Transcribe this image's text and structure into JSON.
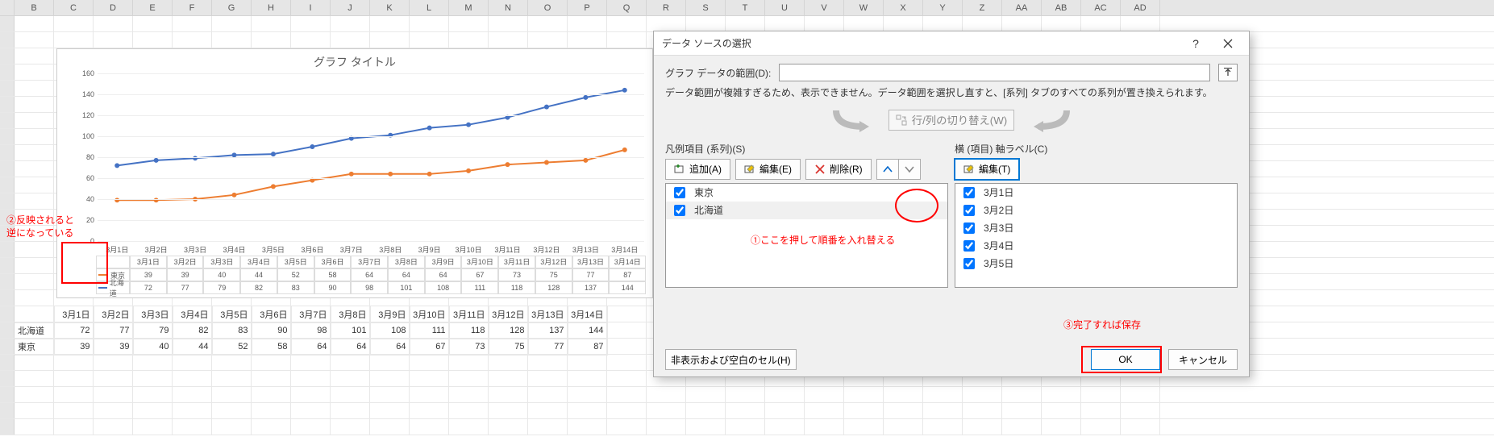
{
  "columns": [
    "B",
    "C",
    "D",
    "E",
    "F",
    "G",
    "H",
    "I",
    "J",
    "K",
    "L",
    "M",
    "N",
    "O",
    "P",
    "Q",
    "R",
    "S",
    "T",
    "U",
    "V",
    "W",
    "X",
    "Y",
    "Z",
    "AA",
    "AB",
    "AC",
    "AD"
  ],
  "rows": [
    "",
    "",
    "",
    "",
    "",
    "",
    "",
    "",
    "",
    "",
    "",
    "",
    "",
    "",
    "",
    "",
    "",
    "",
    "",
    "",
    "",
    "",
    "",
    "",
    "",
    ""
  ],
  "chart": {
    "title": "グラフ タイトル"
  },
  "chart_data": {
    "type": "line",
    "categories": [
      "3月1日",
      "3月2日",
      "3月3日",
      "3月4日",
      "3月5日",
      "3月6日",
      "3月7日",
      "3月8日",
      "3月9日",
      "3月10日",
      "3月11日",
      "3月12日",
      "3月13日",
      "3月14日"
    ],
    "series": [
      {
        "name": "東京",
        "color": "#ed7d31",
        "values": [
          39,
          39,
          40,
          44,
          52,
          58,
          64,
          64,
          64,
          67,
          73,
          75,
          77,
          87
        ]
      },
      {
        "name": "北海道",
        "color": "#4472c4",
        "values": [
          72,
          77,
          79,
          82,
          83,
          90,
          98,
          101,
          108,
          111,
          118,
          128,
          137,
          144
        ]
      }
    ],
    "ylim": [
      0,
      160
    ],
    "ystep": 20
  },
  "sheet": {
    "dates": [
      "3月1日",
      "3月2日",
      "3月3日",
      "3月4日",
      "3月5日",
      "3月6日",
      "3月7日",
      "3月8日",
      "3月9日",
      "3月10日",
      "3月11日",
      "3月12日",
      "3月13日",
      "3月14日"
    ],
    "rows": [
      {
        "label": "北海道",
        "values": [
          72,
          77,
          79,
          82,
          83,
          90,
          98,
          101,
          108,
          111,
          118,
          128,
          137,
          144
        ]
      },
      {
        "label": "東京",
        "values": [
          39,
          39,
          40,
          44,
          52,
          58,
          64,
          64,
          64,
          67,
          73,
          75,
          77,
          87
        ]
      }
    ]
  },
  "annotations": {
    "left1": "②反映されると",
    "left2": "逆になっている",
    "mid": "①ここを押して順番を入れ替える",
    "right": "③完了すれば保存"
  },
  "dialog": {
    "title": "データ ソースの選択",
    "range_label": "グラフ データの範囲(D):",
    "range_value": "",
    "info": "データ範囲が複雑すぎるため、表示できません。データ範囲を選択し直すと、[系列] タブのすべての系列が置き換えられます。",
    "swap_label": "行/列の切り替え(W)",
    "left_panel": {
      "label": "凡例項目 (系列)(S)",
      "add": "追加(A)",
      "edit": "編集(E)",
      "remove": "削除(R)",
      "items": [
        "東京",
        "北海道"
      ]
    },
    "right_panel": {
      "label": "横 (項目) 軸ラベル(C)",
      "edit": "編集(T)",
      "items": [
        "3月1日",
        "3月2日",
        "3月3日",
        "3月4日",
        "3月5日"
      ]
    },
    "hidden_cells": "非表示および空白のセル(H)",
    "ok": "OK",
    "cancel": "キャンセル"
  }
}
